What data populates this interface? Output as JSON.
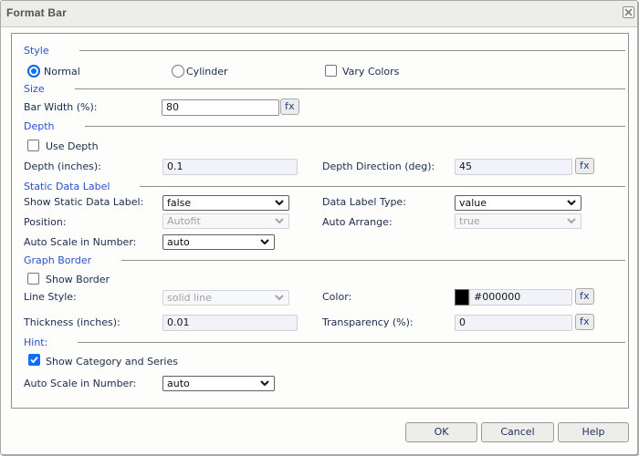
{
  "dialog": {
    "title": "Format Bar"
  },
  "style_section": {
    "header": "Style",
    "normal_label": "Normal",
    "cylinder_label": "Cylinder",
    "vary_colors_label": "Vary Colors"
  },
  "size_section": {
    "header": "Size",
    "bar_width_label": "Bar Width (%):",
    "bar_width_value": "80"
  },
  "depth_section": {
    "header": "Depth",
    "use_depth_label": "Use Depth",
    "depth_label": "Depth (inches):",
    "depth_value": "0.1",
    "direction_label": "Depth Direction (deg):",
    "direction_value": "45"
  },
  "static_data_label_section": {
    "header": "Static Data Label",
    "show_label": "Show Static Data Label:",
    "show_value": "false",
    "type_label": "Data Label Type:",
    "type_value": "value",
    "position_label": "Position:",
    "position_value": "Autofit",
    "arrange_label": "Auto Arrange:",
    "arrange_value": "true",
    "autoscale_label": "Auto Scale in Number:",
    "autoscale_value": "auto"
  },
  "graph_border_section": {
    "header": "Graph Border",
    "show_border_label": "Show Border",
    "line_style_label": "Line Style:",
    "line_style_value": "solid line",
    "color_label": "Color:",
    "color_value": "#000000",
    "color_swatch": "#000000",
    "thickness_label": "Thickness (inches):",
    "thickness_value": "0.01",
    "transparency_label": "Transparency (%):",
    "transparency_value": "0"
  },
  "hint_section": {
    "header": "Hint:",
    "show_category_label": "Show Category and Series",
    "autoscale_label": "Auto Scale in Number:",
    "autoscale_value": "auto"
  },
  "buttons": {
    "ok": "OK",
    "cancel": "Cancel",
    "help": "Help"
  },
  "fx_button_label": "fx",
  "colors": {
    "accent_blue": "#0d6efd",
    "header_blue": "#2b50cc",
    "label_navy": "#1a2b4e"
  }
}
